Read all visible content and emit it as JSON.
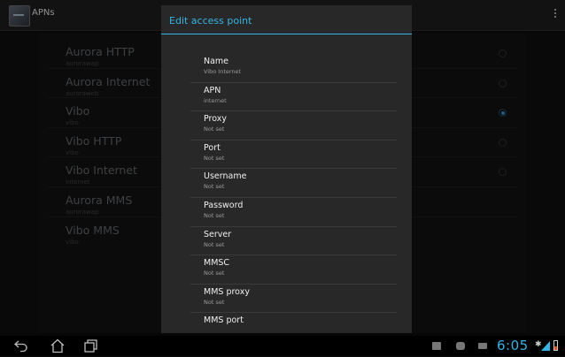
{
  "actionbar": {
    "title": "APNs"
  },
  "apns": [
    {
      "name": "Aurora HTTP",
      "sub": "aurorawap",
      "selected": false
    },
    {
      "name": "Aurora Internet",
      "sub": "auroraweb",
      "selected": false
    },
    {
      "name": "Vibo",
      "sub": "vibo",
      "selected": true
    },
    {
      "name": "Vibo HTTP",
      "sub": "vibo",
      "selected": false
    },
    {
      "name": "Vibo Internet",
      "sub": "internet",
      "selected": false
    },
    {
      "name": "Aurora MMS",
      "sub": "aurorawap",
      "selected": false
    },
    {
      "name": "Vibo MMS",
      "sub": "vibo",
      "selected": false
    }
  ],
  "dialog": {
    "title": "Edit access point",
    "fields": [
      {
        "title": "Name",
        "summary": "Vibo Internet"
      },
      {
        "title": "APN",
        "summary": "internet"
      },
      {
        "title": "Proxy",
        "summary": "Not set"
      },
      {
        "title": "Port",
        "summary": "Not set"
      },
      {
        "title": "Username",
        "summary": "Not set"
      },
      {
        "title": "Password",
        "summary": "Not set"
      },
      {
        "title": "Server",
        "summary": "Not set"
      },
      {
        "title": "MMSC",
        "summary": "Not set"
      },
      {
        "title": "MMS proxy",
        "summary": "Not set"
      },
      {
        "title": "MMS port",
        "summary": ""
      }
    ]
  },
  "statusbar": {
    "clock": "6:05"
  },
  "colors": {
    "accent": "#33b5e5",
    "battery_low": "#e04a2f"
  },
  "icons": [
    "back-icon",
    "home-icon",
    "recent-apps-icon",
    "gallery-notification-icon",
    "chat-notification-icon",
    "mail-notification-icon",
    "bluetooth-icon",
    "signal-icon",
    "battery-icon"
  ]
}
